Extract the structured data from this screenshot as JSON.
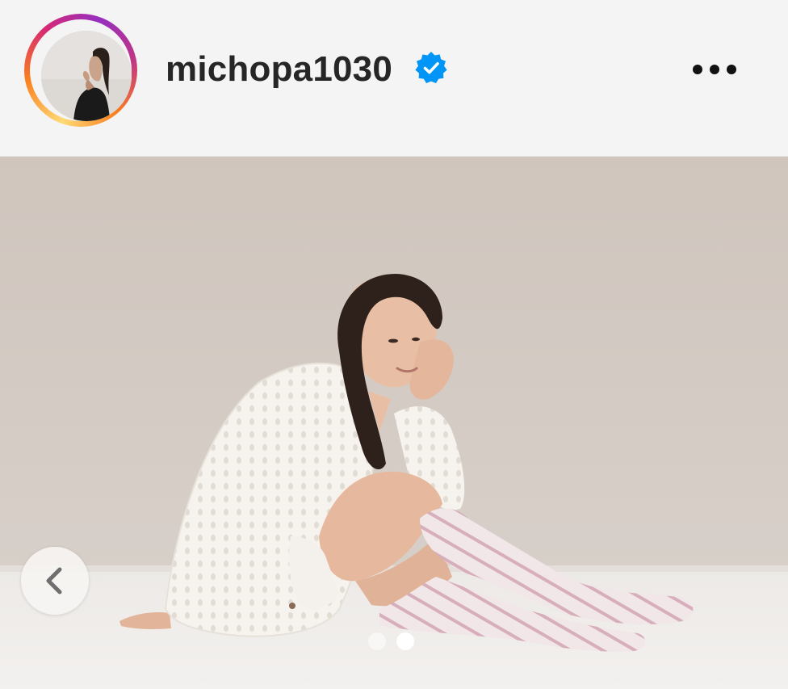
{
  "header": {
    "username": "michopa1030",
    "verified": true,
    "verified_icon": "verified-badge-icon",
    "more_icon": "more-horizontal-icon",
    "avatar_alt": "profile photo",
    "story_ring_colors": [
      "#feda75",
      "#fa7e1e",
      "#d62976",
      "#962fbf"
    ]
  },
  "media": {
    "prev_icon": "chevron-left-icon",
    "carousel": {
      "total": 2,
      "active_index": 1
    }
  },
  "colors": {
    "verified_blue": "#0095f6",
    "text": "#262626",
    "background": "#f4f4f4"
  }
}
